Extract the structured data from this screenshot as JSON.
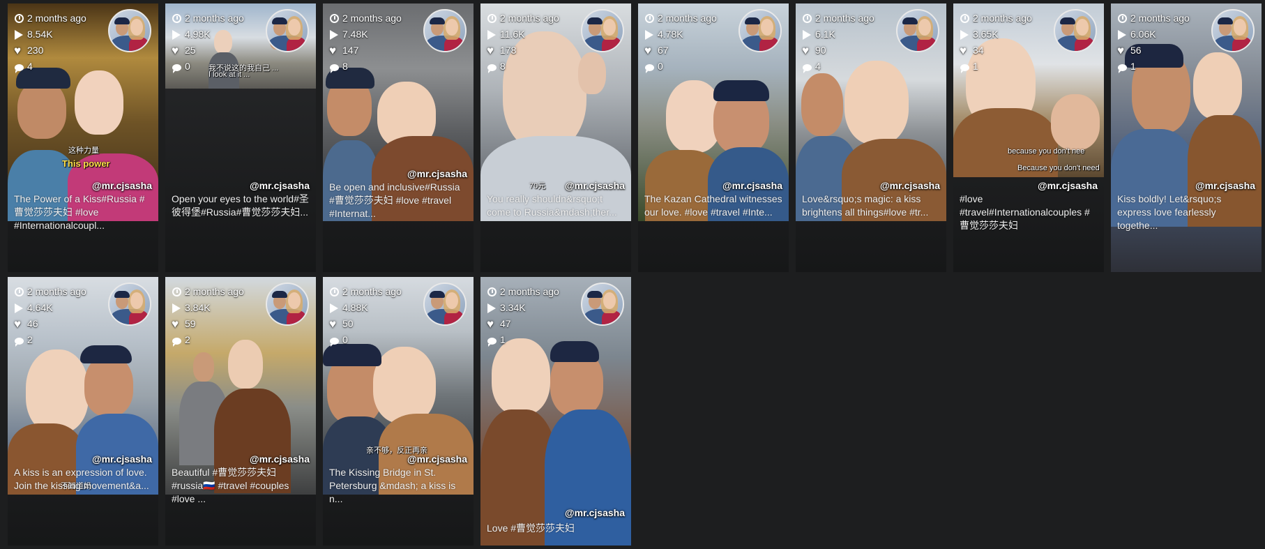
{
  "videos": [
    {
      "age": "2 months ago",
      "views": "8.54K",
      "likes": "230",
      "comments": "4",
      "handle": "@mr.cjsasha",
      "caption": "The Power of a Kiss#Russia #曹觉莎莎夫妇 #love #Internationalcoupl...",
      "subs": [
        "这种力量",
        "This power"
      ],
      "scene": "palace"
    },
    {
      "age": "2 months ago",
      "views": "4.98K",
      "likes": "25",
      "comments": "0",
      "handle": "@mr.cjsasha",
      "caption": "Open your eyes to the world#圣彼得堡#Russia#曹觉莎莎夫妇...",
      "subs": [
        "我不说这的我自己 ...",
        "I look at it ..."
      ],
      "scene": "street-wide"
    },
    {
      "age": "2 months ago",
      "views": "7.48K",
      "likes": "147",
      "comments": "8",
      "handle": "@mr.cjsasha",
      "caption": "Be open and inclusive#Russia #曹觉莎莎夫妇 #love #travel #Internat...",
      "subs": [],
      "scene": "balcony"
    },
    {
      "age": "2 months ago",
      "views": "11.6K",
      "likes": "178",
      "comments": "8",
      "handle": "@mr.cjsasha",
      "caption": "You really shouldn&rsquo;t come to Russia&mdash;ther...",
      "subs": [
        "70元"
      ],
      "scene": "rain"
    },
    {
      "age": "2 months ago",
      "views": "4.78K",
      "likes": "67",
      "comments": "0",
      "handle": "@mr.cjsasha",
      "caption": "The Kazan Cathedral witnesses our love. #love #travel #Inte...",
      "subs": [],
      "scene": "cathedral"
    },
    {
      "age": "2 months ago",
      "views": "6.1K",
      "likes": "90",
      "comments": "4",
      "handle": "@mr.cjsasha",
      "caption": "Love&rsquo;s magic: a kiss brightens all things#love #tr...",
      "subs": [],
      "scene": "bridge"
    },
    {
      "age": "2 months ago",
      "views": "3.65K",
      "likes": "34",
      "comments": "1",
      "handle": "@mr.cjsasha",
      "caption": "#love #travel#Internationalcouples #曹觉莎莎夫妇",
      "subs": [
        "because you don't nee",
        "Because you don't need"
      ],
      "scene": "river"
    },
    {
      "age": "2 months ago",
      "views": "6.06K",
      "likes": "56",
      "comments": "1",
      "handle": "@mr.cjsasha",
      "caption": "Kiss boldly! Let&rsquo;s express love fearlessly togethe...",
      "subs": [],
      "scene": "selfie"
    },
    {
      "age": "2 months ago",
      "views": "4.64K",
      "likes": "46",
      "comments": "2",
      "handle": "@mr.cjsasha",
      "caption": "A kiss is an expression of love. Join the kissing movement&a...",
      "subs": [
        "不知道妈"
      ],
      "scene": "seagull"
    },
    {
      "age": "2 months ago",
      "views": "3.84K",
      "likes": "59",
      "comments": "2",
      "handle": "@mr.cjsasha",
      "caption": "Beautiful #曹觉莎莎夫妇 #russia🇷🇺 #travel #couples #love ...",
      "subs": [],
      "scene": "street"
    },
    {
      "age": "2 months ago",
      "views": "4.88K",
      "likes": "50",
      "comments": "0",
      "handle": "@mr.cjsasha",
      "caption": "The Kissing Bridge in St. Petersburg &mdash; a kiss is n...",
      "subs": [
        "亲不够，反正再亲"
      ],
      "scene": "kiss-bridge"
    },
    {
      "age": "2 months ago",
      "views": "3.34K",
      "likes": "47",
      "comments": "1",
      "handle": "@mr.cjsasha",
      "caption": "Love #曹觉莎莎夫妇",
      "subs": [],
      "scene": "canal"
    }
  ]
}
